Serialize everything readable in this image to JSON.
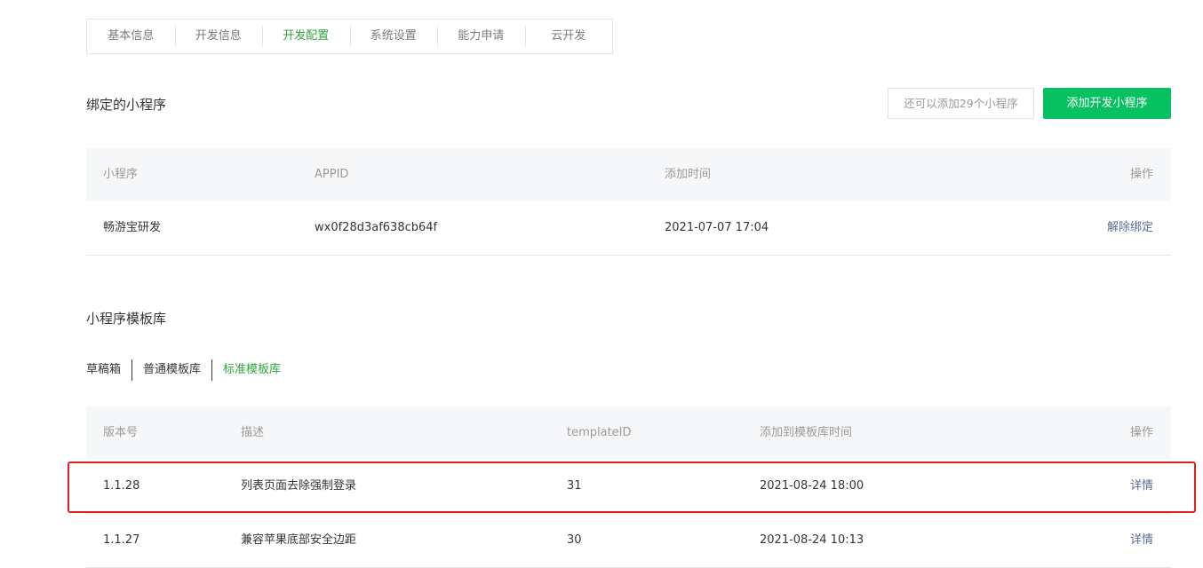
{
  "tabs": [
    "基本信息",
    "开发信息",
    "开发配置",
    "系统设置",
    "能力申请",
    "云开发"
  ],
  "active_tab_index": 2,
  "bound": {
    "title": "绑定的小程序",
    "quota_text": "还可以添加29个小程序",
    "add_button": "添加开发小程序",
    "headers": [
      "小程序",
      "APPID",
      "添加时间",
      "操作"
    ],
    "rows": [
      {
        "name": "畅游宝研发",
        "appid": "wx0f28d3af638cb64f",
        "time": "2021-07-07 17:04",
        "action": "解除绑定"
      }
    ]
  },
  "templates": {
    "title": "小程序模板库",
    "subtabs": [
      "草稿箱",
      "普通模板库",
      "标准模板库"
    ],
    "active_subtab_index": 2,
    "headers": [
      "版本号",
      "描述",
      "templateID",
      "添加到模板库时间",
      "操作"
    ],
    "rows": [
      {
        "version": "1.1.28",
        "desc": "列表页面去除强制登录",
        "template_id": "31",
        "time": "2021-08-24 18:00",
        "action": "详情"
      },
      {
        "version": "1.1.27",
        "desc": "兼容苹果底部安全边距",
        "template_id": "30",
        "time": "2021-08-24 10:13",
        "action": "详情"
      }
    ]
  },
  "colors": {
    "accent_green": "#07c160",
    "active_text": "#31a23f",
    "link": "#576b95",
    "highlight_border": "#e01f1f"
  }
}
